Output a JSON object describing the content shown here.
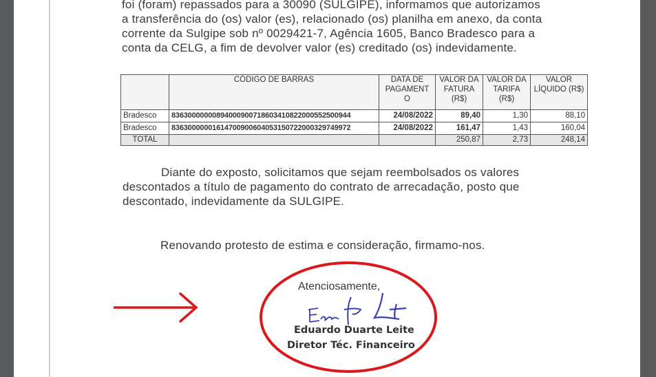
{
  "paragraph1": {
    "lines": [
      "foi (foram) repassados para a 30090 (SULGIPE), informamos que autorizamos",
      "a transferência do (os) valor (es), relacionado (os) planilha em anexo, da conta",
      "corrente da Sulgipe sob nº 0029421-7, Agência 1605, Banco Bradesco para a",
      "conta da CELG, a fim de devolver valor (es) creditado (os) indevidamente."
    ]
  },
  "table": {
    "headers": [
      "",
      "CÓDIGO DE BARRAS",
      "DATA DE PAGAMENTO",
      "VALOR DA FATURA (R$)",
      "VALOR DA TARIFA (R$)",
      "VALOR LÍQUIDO (R$)"
    ],
    "header_display": {
      "date": [
        "DATA DE",
        "PAGAMENT",
        "O"
      ],
      "fatura": [
        "VALOR DA",
        "FATURA",
        "(R$)"
      ],
      "tarifa": [
        "VALOR DA",
        "TARIFA",
        "(R$)"
      ],
      "liquido": [
        "VALOR",
        "LÍQUIDO (R$)"
      ]
    },
    "rows": [
      {
        "bank": "Bradesco",
        "code": "83630000000894000900718603410822000552500944",
        "date": "24/08/2022",
        "fatura": "89,40",
        "tarifa": "1,30",
        "liquido": "88,10"
      },
      {
        "bank": "Bradesco",
        "code": "83630000001614700900604053150722000329749972",
        "date": "24/08/2022",
        "fatura": "161,47",
        "tarifa": "1,43",
        "liquido": "160,04"
      }
    ],
    "total": {
      "label": "TOTAL",
      "fatura": "250,87",
      "tarifa": "2,73",
      "liquido": "248,14"
    }
  },
  "paragraph2": {
    "lines": [
      "Diante do exposto, solicitamos que sejam reembolsados os valores",
      "descontados a título de pagamento do contrato de arrecadação, posto que",
      "descontado, indevidamente da SULGIPE."
    ]
  },
  "paragraph3": "Renovando protesto de estima e consideração, firmamo-nos.",
  "signature": {
    "closing": "Atenciosamente,",
    "name": "Eduardo Duarte Leite",
    "role": "Diretor Téc. Financeiro",
    "ink_color": "#3a3fae"
  },
  "annotations": {
    "arrow_color": "#d9191c",
    "circle_color": "#d9191c"
  }
}
